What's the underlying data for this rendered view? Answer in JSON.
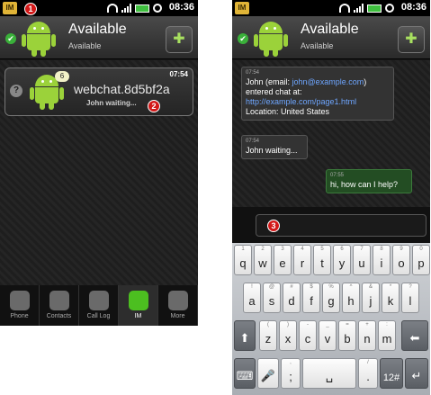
{
  "status": {
    "app_badge": "IM",
    "time": "08:36"
  },
  "header": {
    "title": "Available",
    "subtitle": "Available",
    "check": "✔",
    "add_glyph": "✚"
  },
  "chat_item": {
    "unread": "6",
    "name": "webchat.8d5bf2a",
    "preview": "John waiting...",
    "time": "07:54",
    "help": "?"
  },
  "markers": [
    "1",
    "2",
    "3"
  ],
  "tabs": [
    {
      "label": "Phone",
      "icon": "phone-icon"
    },
    {
      "label": "Contacts",
      "icon": "contacts-icon"
    },
    {
      "label": "Call Log",
      "icon": "call-log-icon"
    },
    {
      "label": "IM",
      "icon": "im-icon"
    },
    {
      "label": "More",
      "icon": "more-icon"
    }
  ],
  "messages": {
    "m1": {
      "time": "07:54",
      "line1": "John (email: ",
      "email": "john@example.com",
      "line1_end": ")",
      "line2": "entered chat at:",
      "url": "http://example.com/page1.html",
      "location": "Location: United States"
    },
    "m2": {
      "time": "07:54",
      "text": "John waiting..."
    },
    "m3": {
      "time": "07:55",
      "text": "hi, how can I help?"
    }
  },
  "keyboard": {
    "row1": [
      {
        "main": "q",
        "alt": "1"
      },
      {
        "main": "w",
        "alt": "2"
      },
      {
        "main": "e",
        "alt": "3"
      },
      {
        "main": "r",
        "alt": "4"
      },
      {
        "main": "t",
        "alt": "5"
      },
      {
        "main": "y",
        "alt": "6"
      },
      {
        "main": "u",
        "alt": "7"
      },
      {
        "main": "i",
        "alt": "8"
      },
      {
        "main": "o",
        "alt": "9"
      },
      {
        "main": "p",
        "alt": "0"
      }
    ],
    "row2": [
      {
        "main": "a",
        "alt": "!"
      },
      {
        "main": "s",
        "alt": "@"
      },
      {
        "main": "d",
        "alt": "#"
      },
      {
        "main": "f",
        "alt": "$"
      },
      {
        "main": "g",
        "alt": "%"
      },
      {
        "main": "h",
        "alt": "^"
      },
      {
        "main": "j",
        "alt": "&"
      },
      {
        "main": "k",
        "alt": "*"
      },
      {
        "main": "l",
        "alt": "?"
      }
    ],
    "row3": [
      {
        "main": "z",
        "alt": "("
      },
      {
        "main": "x",
        "alt": ")"
      },
      {
        "main": "c",
        "alt": "-"
      },
      {
        "main": "v",
        "alt": "_"
      },
      {
        "main": "b",
        "alt": "="
      },
      {
        "main": "n",
        "alt": "+"
      },
      {
        "main": "m",
        "alt": ":"
      }
    ],
    "shift": "⬆",
    "backspace": "⬅",
    "settings": "⌨",
    "mic": "🎤",
    "punct": ";",
    "punct_alt": ",",
    "space": "␣",
    "period": ".",
    "period_alt": "/",
    "symbols": "12#",
    "enter": "↵"
  }
}
